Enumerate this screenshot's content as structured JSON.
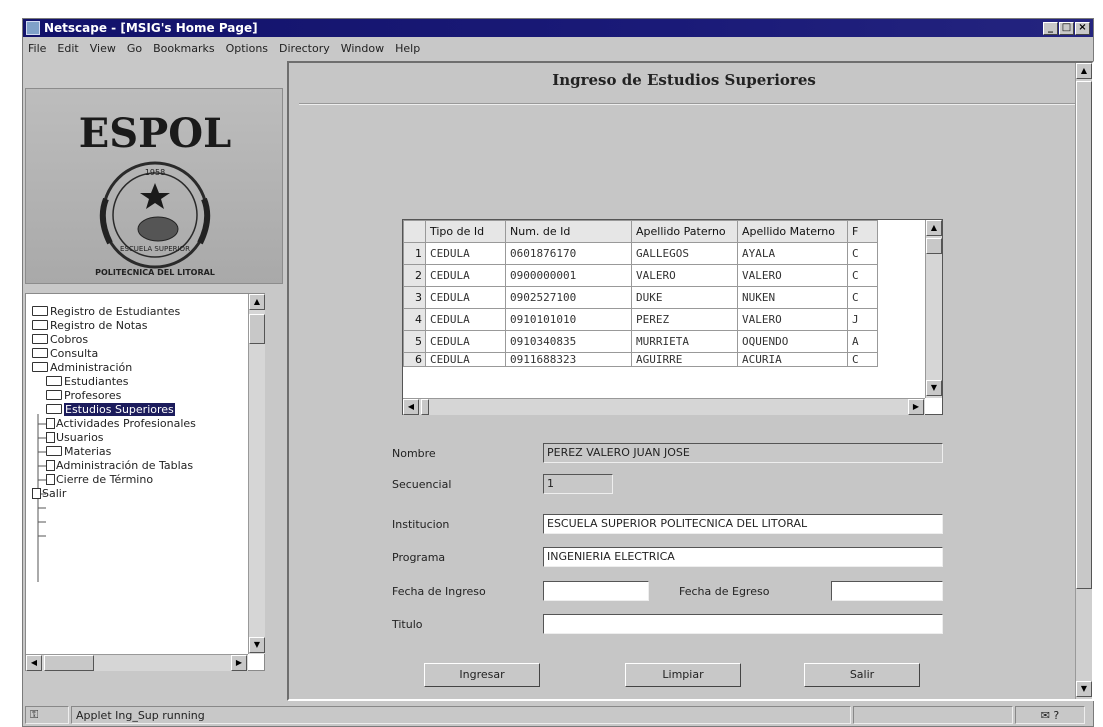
{
  "window": {
    "title": "Netscape - [MSIG's Home Page]",
    "buttons": [
      "_",
      "□",
      "×"
    ]
  },
  "menu": [
    "File",
    "Edit",
    "View",
    "Go",
    "Bookmarks",
    "Options",
    "Directory",
    "Window",
    "Help"
  ],
  "logo": {
    "text": "ESPOL",
    "year": "1958",
    "ring_text": "ESCUELA SUPERIOR",
    "bottom_text": "POLITECNICA DEL LITORAL"
  },
  "tree": {
    "items": [
      {
        "label": "Registro de Estudiantes",
        "type": "folder"
      },
      {
        "label": "Registro de Notas",
        "type": "folder"
      },
      {
        "label": "Cobros",
        "type": "folder"
      },
      {
        "label": "Consulta",
        "type": "folder"
      },
      {
        "label": "Administración",
        "type": "folder-open"
      },
      {
        "label": "Estudiantes",
        "type": "folder"
      },
      {
        "label": "Profesores",
        "type": "folder"
      },
      {
        "label": "Estudios Superiores",
        "type": "folder",
        "selected": true
      },
      {
        "label": "Actividades Profesionales",
        "type": "doc"
      },
      {
        "label": "Usuarios",
        "type": "doc"
      },
      {
        "label": "Materias",
        "type": "folder"
      },
      {
        "label": "Administración de Tablas",
        "type": "doc"
      },
      {
        "label": "Cierre de Término",
        "type": "doc"
      },
      {
        "label": "Salir",
        "type": "doc"
      }
    ]
  },
  "form": {
    "title": "Ingreso de Estudios Superiores",
    "grid": {
      "columns": [
        "Tipo de Id",
        "Num. de Id",
        "Apellido Paterno",
        "Apellido Materno",
        "F"
      ],
      "rows": [
        {
          "n": "1",
          "tipo": "CEDULA",
          "num": "0601876170",
          "pat": "GALLEGOS",
          "mat": "AYALA",
          "x": "C"
        },
        {
          "n": "2",
          "tipo": "CEDULA",
          "num": "0900000001",
          "pat": "VALERO",
          "mat": "VALERO",
          "x": "C"
        },
        {
          "n": "3",
          "tipo": "CEDULA",
          "num": "0902527100",
          "pat": "DUKE",
          "mat": "NUKEN",
          "x": "C"
        },
        {
          "n": "4",
          "tipo": "CEDULA",
          "num": "0910101010",
          "pat": "PEREZ",
          "mat": "VALERO",
          "x": "J"
        },
        {
          "n": "5",
          "tipo": "CEDULA",
          "num": "0910340835",
          "pat": "MURRIETA",
          "mat": "OQUENDO",
          "x": "A"
        },
        {
          "n": "6",
          "tipo": "CEDULA",
          "num": "0911688323",
          "pat": "AGUIRRE",
          "mat": "ACURIA",
          "x": "C"
        }
      ]
    },
    "fields": {
      "nombre_label": "Nombre",
      "nombre_value": "PEREZ VALERO JUAN JOSE",
      "secuencial_label": "Secuencial",
      "secuencial_value": "1",
      "institucion_label": "Institucion",
      "institucion_value": "ESCUELA SUPERIOR POLITECNICA DEL LITORAL",
      "programa_label": "Programa",
      "programa_value": "INGENIERIA ELECTRICA",
      "fecha_ingreso_label": "Fecha de Ingreso",
      "fecha_ingreso_value": "",
      "fecha_egreso_label": "Fecha de Egreso",
      "fecha_egreso_value": "",
      "titulo_label": "Titulo",
      "titulo_value": ""
    },
    "buttons": {
      "ingresar": "Ingresar",
      "limpiar": "Limpiar",
      "salir": "Salir"
    }
  },
  "status": {
    "text": "Applet Ing_Sup running"
  }
}
